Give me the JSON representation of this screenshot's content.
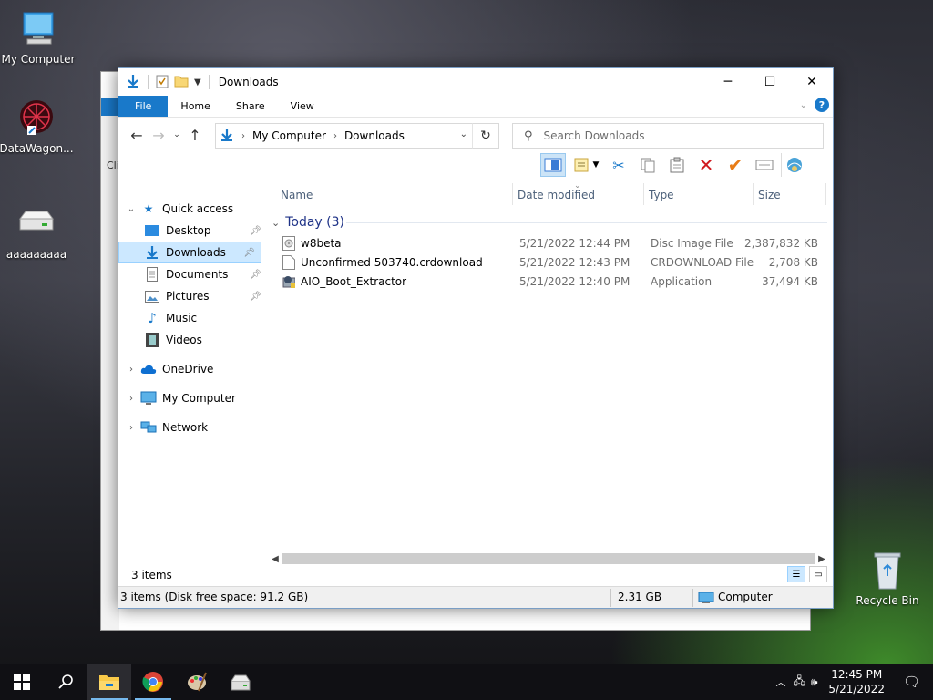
{
  "desktop": {
    "icons": [
      {
        "label": "My Computer"
      },
      {
        "label": "DataWagon..."
      },
      {
        "label": "aaaaaaaaa"
      },
      {
        "label": "Recycle Bin"
      }
    ],
    "bg_window_text": "Cli"
  },
  "window": {
    "title": "Downloads",
    "ribbon_tabs": [
      "File",
      "Home",
      "Share",
      "View"
    ],
    "help_label": "?",
    "address": {
      "crumbs": [
        "My Computer",
        "Downloads"
      ]
    },
    "search_placeholder": "Search Downloads"
  },
  "navpane": {
    "quick_access": "Quick access",
    "items": [
      {
        "label": "Desktop"
      },
      {
        "label": "Downloads"
      },
      {
        "label": "Documents"
      },
      {
        "label": "Pictures"
      },
      {
        "label": "Music"
      },
      {
        "label": "Videos"
      }
    ],
    "roots": [
      {
        "label": "OneDrive"
      },
      {
        "label": "My Computer"
      },
      {
        "label": "Network"
      }
    ]
  },
  "columns": {
    "name": "Name",
    "date": "Date modified",
    "type": "Type",
    "size": "Size"
  },
  "group": {
    "label": "Today (3)"
  },
  "files": [
    {
      "name": "w8beta",
      "date": "5/21/2022 12:44 PM",
      "type": "Disc Image File",
      "size": "2,387,832 KB"
    },
    {
      "name": "Unconfirmed 503740.crdownload",
      "date": "5/21/2022 12:43 PM",
      "type": "CRDOWNLOAD File",
      "size": "2,708 KB"
    },
    {
      "name": "AIO_Boot_Extractor",
      "date": "5/21/2022 12:40 PM",
      "type": "Application",
      "size": "37,494 KB"
    }
  ],
  "status": {
    "item_count": "3 items",
    "bar_left": "3 items (Disk free space: 91.2 GB)",
    "bar_size": "2.31 GB",
    "bar_location": "Computer"
  },
  "taskbar": {
    "time": "12:45 PM",
    "date": "5/21/2022"
  },
  "colors": {
    "accent": "#1979ca",
    "selection": "#cce8ff"
  }
}
